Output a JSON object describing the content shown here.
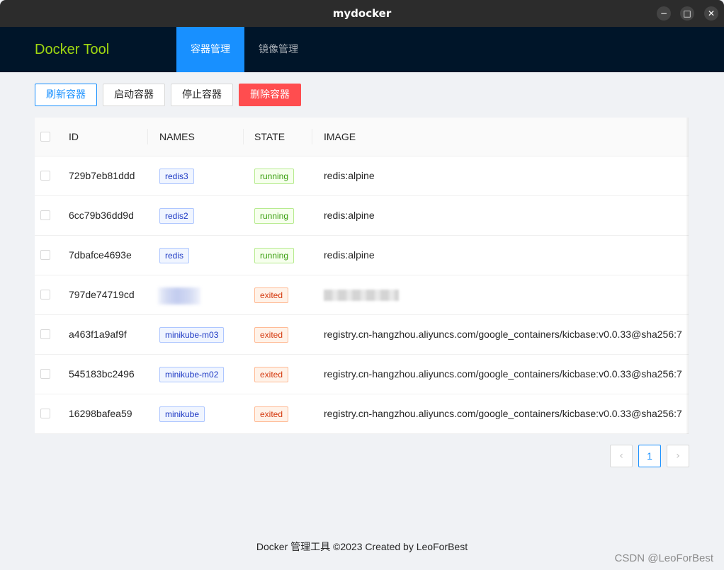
{
  "window": {
    "title": "mydocker",
    "minimize_glyph": "−",
    "maximize_glyph": "□",
    "close_glyph": "✕"
  },
  "header": {
    "brand": "Docker Tool",
    "tabs": [
      {
        "label": "容器管理",
        "active": true
      },
      {
        "label": "镜像管理",
        "active": false
      }
    ]
  },
  "toolbar": {
    "refresh_label": "刷新容器",
    "start_label": "启动容器",
    "stop_label": "停止容器",
    "delete_label": "删除容器"
  },
  "table": {
    "columns": [
      "ID",
      "NAMES",
      "STATE",
      "IMAGE"
    ],
    "rows": [
      {
        "id": "729b7eb81ddd",
        "name": "redis3",
        "state": "running",
        "image": "redis:alpine"
      },
      {
        "id": "6cc79b36dd9d",
        "name": "redis2",
        "state": "running",
        "image": "redis:alpine"
      },
      {
        "id": "7dbafce4693e",
        "name": "redis",
        "state": "running",
        "image": "redis:alpine"
      },
      {
        "id": "797de74719cd",
        "name": "",
        "state": "exited",
        "image": ""
      },
      {
        "id": "a463f1a9af9f",
        "name": "minikube-m03",
        "state": "exited",
        "image": "registry.cn-hangzhou.aliyuncs.com/google_containers/kicbase:v0.0.33@sha256:7"
      },
      {
        "id": "545183bc2496",
        "name": "minikube-m02",
        "state": "exited",
        "image": "registry.cn-hangzhou.aliyuncs.com/google_containers/kicbase:v0.0.33@sha256:7"
      },
      {
        "id": "16298bafea59",
        "name": "minikube",
        "state": "exited",
        "image": "registry.cn-hangzhou.aliyuncs.com/google_containers/kicbase:v0.0.33@sha256:7"
      }
    ]
  },
  "pagination": {
    "prev_glyph": "‹",
    "current": "1",
    "next_glyph": "›"
  },
  "footer": {
    "text": "Docker 管理工具 ©2023 Created by LeoForBest"
  },
  "watermark": "CSDN @LeoForBest",
  "colors": {
    "primary": "#1890ff",
    "danger": "#ff4d4f",
    "brand": "#a0d911",
    "header_bg": "#001529"
  }
}
